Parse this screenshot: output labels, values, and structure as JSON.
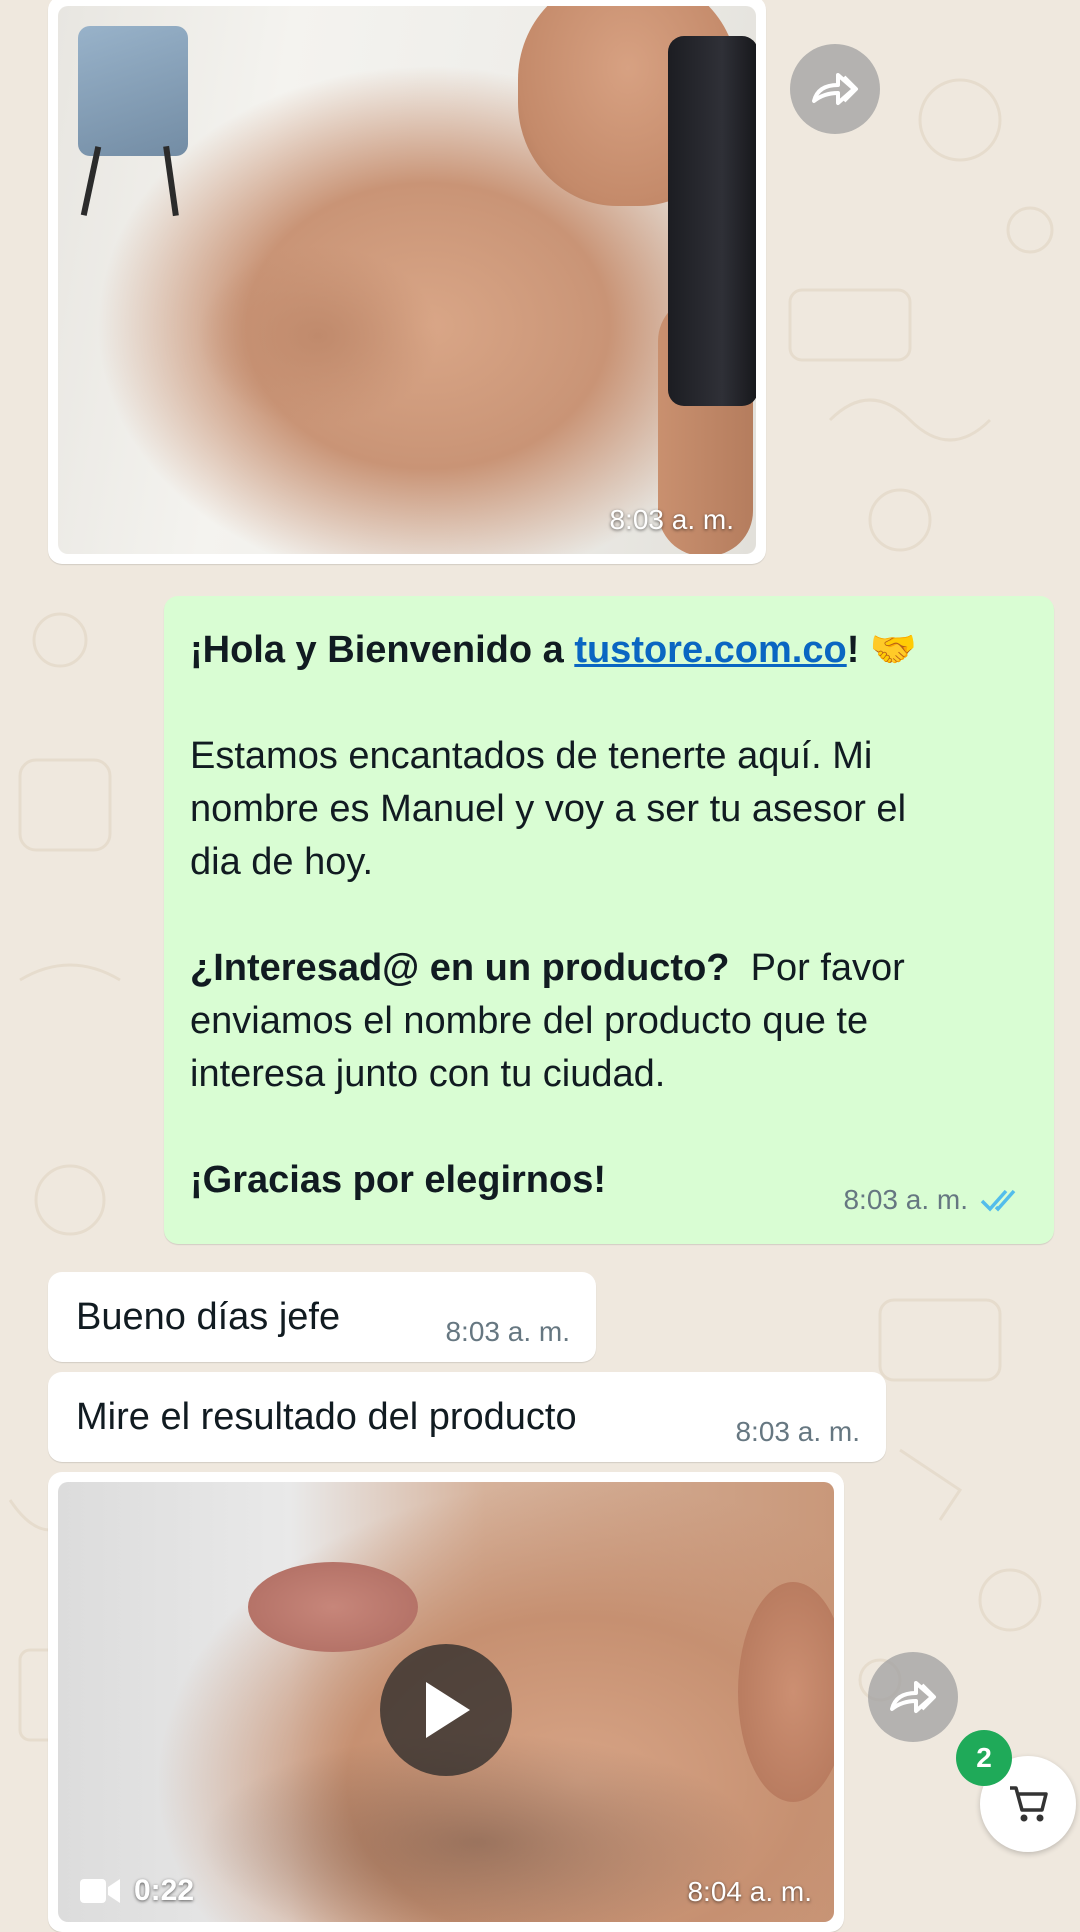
{
  "messages": {
    "image_message": {
      "time": "8:03 a. m."
    },
    "welcome": {
      "greeting_prefix": "¡Hola y Bienvenido a ",
      "link_text": "tustore.com.co",
      "greeting_suffix": "!",
      "emoji": "🤝",
      "paragraph1_line1": "Estamos encantados de tenerte aquí. Mi",
      "paragraph1_line2": "nombre es Manuel y voy a ser tu asesor el",
      "paragraph1_line3": "dia de hoy.",
      "question_bold": "¿Interesad@ en un producto?",
      "question_rest": "  Por favor",
      "paragraph2_line2": "enviamos el nombre del producto que te",
      "paragraph2_line3": "interesa junto con tu ciudad.",
      "closing": "¡Gracias por elegirnos!",
      "time": "8:03 a. m.",
      "status_icon": "double-check-read-icon",
      "status_color": "#53bdeb"
    },
    "incoming_1": {
      "text": "Bueno días jefe",
      "time": "8:03 a. m."
    },
    "incoming_2": {
      "text": "Mire el resultado del producto",
      "time": "8:03 a. m."
    },
    "video_message": {
      "duration": "0:22",
      "time": "8:04 a. m."
    }
  },
  "cart": {
    "badge_count": "2",
    "icon": "cart-icon",
    "badge_color": "#1faa59"
  },
  "colors": {
    "outgoing_bubble": "#d9fdd3",
    "incoming_bubble": "#ffffff",
    "chat_background": "#efe8de",
    "link": "#0a66c2"
  }
}
